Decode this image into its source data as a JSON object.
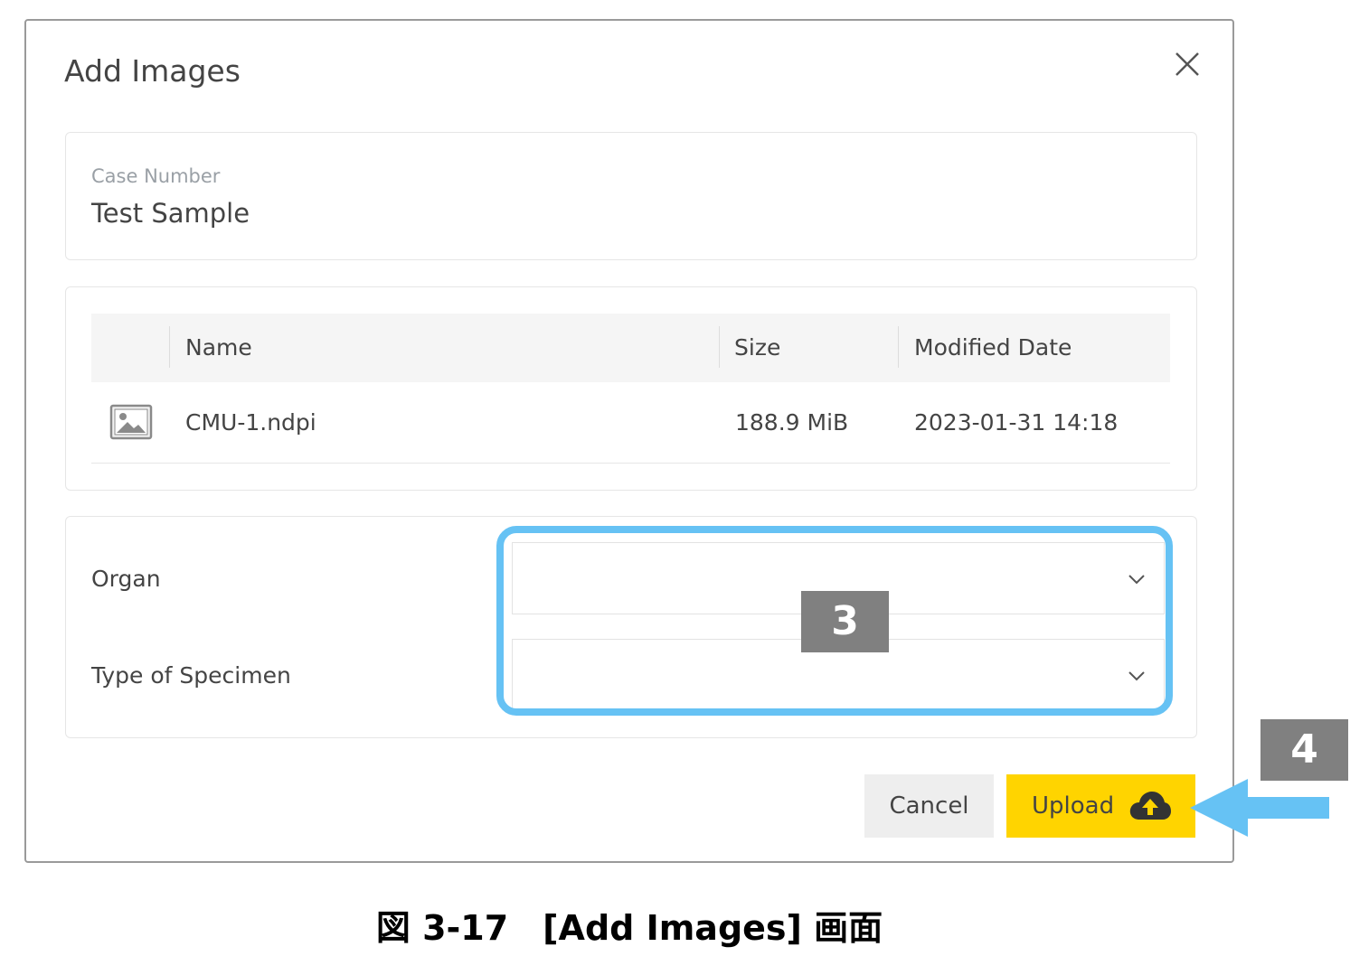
{
  "dialog": {
    "title": "Add Images",
    "close_icon": "close-icon"
  },
  "case": {
    "label": "Case Number",
    "value": "Test Sample"
  },
  "files_table": {
    "columns": [
      "Name",
      "Size",
      "Modified Date"
    ],
    "rows": [
      {
        "icon": "image-file-icon",
        "name": "CMU-1.ndpi",
        "size": "188.9 MiB",
        "modified": "2023-01-31 14:18"
      }
    ]
  },
  "metadata": {
    "organ": {
      "label": "Organ",
      "value": ""
    },
    "specimen": {
      "label": "Type of Specimen",
      "value": ""
    }
  },
  "buttons": {
    "cancel": "Cancel",
    "upload": "Upload",
    "upload_icon": "cloud-upload-icon"
  },
  "annotations": {
    "callout_3": "3",
    "callout_4": "4",
    "highlight_color": "#66c2f4",
    "callout_color": "#808080"
  },
  "caption": "図 3-17　[Add Images] 画面",
  "colors": {
    "upload_button": "#ffd400",
    "cancel_button": "#eeeeee",
    "header_row": "#f5f5f5"
  }
}
